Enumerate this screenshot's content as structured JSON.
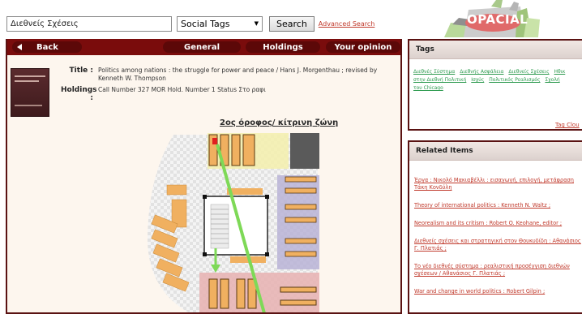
{
  "search": {
    "value": "Διεθνείς Σχέσεις",
    "field_selected": "Social Tags",
    "button_label": "Search",
    "advanced_link": "Advanced Search"
  },
  "logo": {
    "text": "OPACIAL"
  },
  "nav": {
    "back_label": "Back",
    "tabs": [
      "General",
      "Holdings",
      "Your opinion"
    ]
  },
  "record": {
    "title_label": "Title :",
    "title_value": "Politics among nations : the struggle for power and peace / Hans J. Morgenthau ; revised by Kenneth W. Thompson",
    "holdings_label": "Holdings :",
    "holdings_value": "Call Number 327 MOR Hold. Number 1 Status Στο ραφι"
  },
  "map": {
    "title": "2ος όροφος/ κίτρινη ζώνη"
  },
  "tags": {
    "heading": "Tags",
    "line1": [
      "Διεθνές Σύστημα",
      "Διεθνής Ασφάλεια",
      "Διεθνείς Σχέσεις",
      "Ηθικ"
    ],
    "line2": [
      "στην Διεθνή Πολιτική",
      "Ισχύς",
      "Πολιτικός Ρεαλισμός",
      "Σχολή"
    ],
    "line3": [
      "του Chicago"
    ],
    "cloud_link": "Tag Clou"
  },
  "related": {
    "heading": "Related Items",
    "items": [
      "Έργα : Νικολό Μακιαβέλλι : εισαγωγή, επιλογή, μετάφραση Τάκη Κονδύλη",
      "Theory of international politics : Kenneth N. Waltz ;",
      "Neorealism and its critism : Robert O. Keohane, editor ;",
      "Διεθνείς σχέσεις και στρατηγική στον Θουκυδίδη : Αθανάσιος Γ. Πλατιάς ;",
      "Το νέο διεθνές σύστημα : ρεαλιστική προσέγγιση διεθνών σχέσεων / Αθανάσιος Γ. Πλατιάς ;",
      "War and change in world politics : Robert Gilpin ;"
    ]
  },
  "colors": {
    "nav_bg": "#7a0c0c",
    "link_red": "#c0392b",
    "tag_green": "#2c9a4e",
    "path_green": "#7ed957"
  }
}
